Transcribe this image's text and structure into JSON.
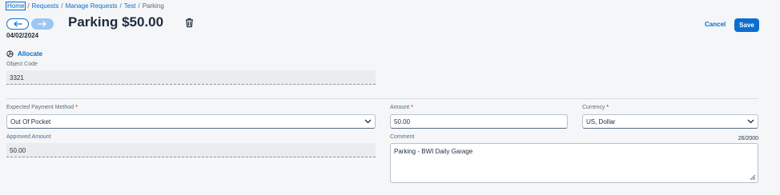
{
  "breadcrumb": {
    "items": [
      "Home",
      "Requests",
      "Manage Requests",
      "Test"
    ],
    "current": "Parking",
    "separator": "/"
  },
  "header": {
    "title": "Parking $50.00",
    "date": "04/02/2024",
    "cancel_label": "Cancel",
    "save_label": "Save",
    "back_icon": "arrow-left-icon",
    "forward_icon": "arrow-right-icon",
    "delete_icon": "trash-icon"
  },
  "allocate": {
    "label": "Allocate",
    "icon": "allocate-icon"
  },
  "fields": {
    "object_code": {
      "label": "Object Code",
      "value": "3321"
    },
    "payment_method": {
      "label": "Expected Payment Method",
      "required": "*",
      "value": "Out Of Pocket"
    },
    "approved_amount": {
      "label": "Approved Amount",
      "value": "50.00"
    },
    "amount": {
      "label": "Amount",
      "required": "*",
      "value": "50.00"
    },
    "currency": {
      "label": "Currency",
      "required": "*",
      "value": "US, Dollar"
    },
    "comment": {
      "label": "Comment",
      "value": "Parking - BWI Daily Garage",
      "counter": "26/2000"
    }
  },
  "colors": {
    "accent": "#0a6ed1",
    "background": "#f5f6f7",
    "required": "#cc0000"
  }
}
